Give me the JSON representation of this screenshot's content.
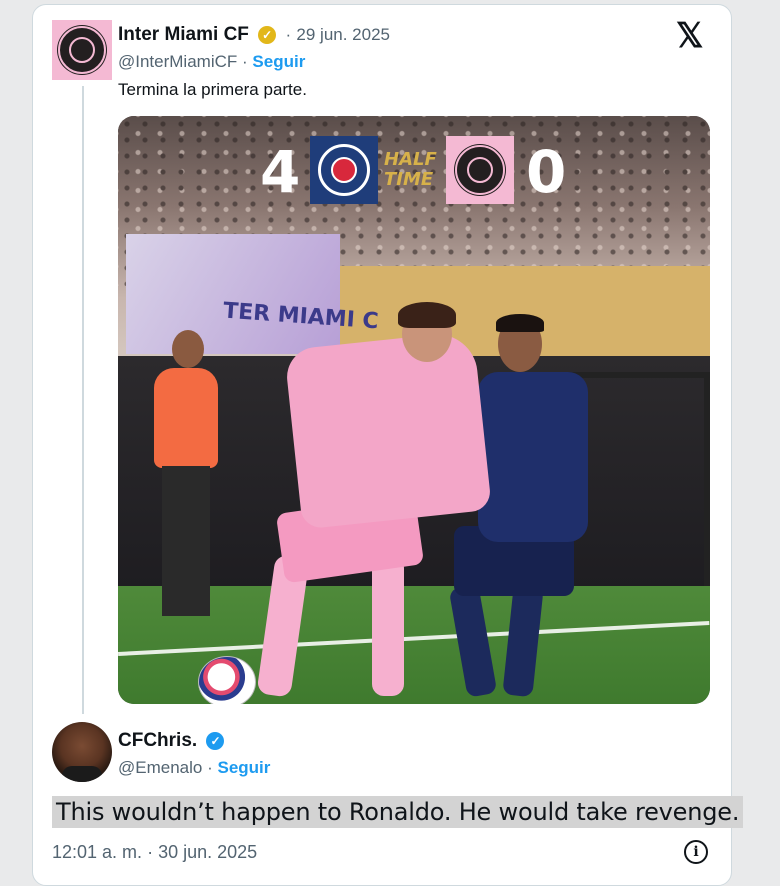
{
  "tweet": {
    "author_name": "Inter Miami CF",
    "separator": "·",
    "date": "29 jun. 2025",
    "handle": "@InterMiamiCF",
    "follow_label": "Seguir",
    "text": "Termina la primera parte.",
    "verified_badge_color": "#e2b719",
    "avatar_background": "#f4b9d3"
  },
  "media": {
    "home_score": "4",
    "away_score": "0",
    "status_line1": "HALF",
    "status_line2": "TIME",
    "home_badge_text": "PARIS",
    "banner_text": "TER MIAMI C"
  },
  "reply": {
    "author_name": "CFChris.",
    "handle": "@Emenalo",
    "follow_label": "Seguir",
    "text": "This wouldn’t happen to Ronaldo. He would take revenge.",
    "verified_badge_color": "#1d9bf0"
  },
  "footer": {
    "time": "12:01 a. m.",
    "separator": "·",
    "date": "30 jun. 2025"
  },
  "icons": {
    "platform": "x-logo-icon",
    "info": "info-icon",
    "verified": "verified-badge-icon"
  },
  "colors": {
    "link": "#1d9bf0",
    "text": "#0f1419",
    "muted": "#536471",
    "highlight": "#d3d3d3"
  }
}
